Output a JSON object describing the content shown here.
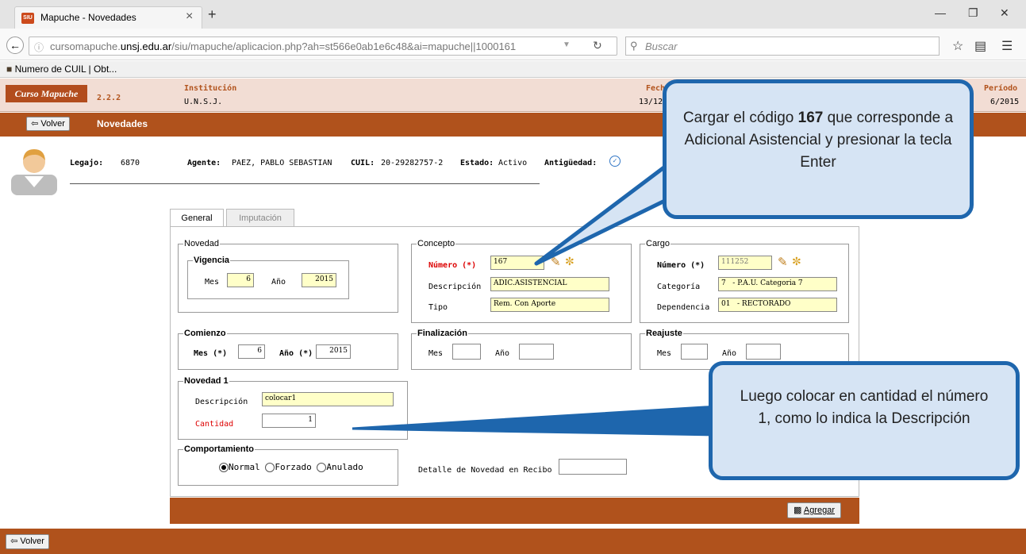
{
  "browser": {
    "tab_title": "Mapuche - Novedades",
    "tab_close": "×",
    "new_tab": "+",
    "url_prefix": "cursomapuche.",
    "url_domain": "unsj.edu.ar",
    "url_path": "/siu/mapuche/aplicacion.php?ah=st566e0ab1e6c48&ai=mapuche||1000161",
    "search_placeholder": "Buscar",
    "bookmark": "Numero de CUIL | Obt..."
  },
  "header": {
    "logo": "Curso Mapuche",
    "version": "2.2.2",
    "institucion_label": "Institución",
    "institucion_value": "U.N.S.J.",
    "fecha_label": "Fech",
    "fecha_value": "13/12/",
    "periodo_label": "Período",
    "periodo_value": "6/2015"
  },
  "toolbar": {
    "volver": "Volver",
    "title": "Novedades"
  },
  "agent": {
    "legajo_label": "Legajo:",
    "legajo_value": "6870",
    "agente_label": "Agente:",
    "agente_value": "PAEZ, PABLO SEBASTIAN",
    "cuil_label": "CUIL:",
    "cuil_value": "20-29282757-2",
    "estado_label": "Estado:",
    "estado_value": "Activo",
    "antiguedad_label": "Antigüedad:"
  },
  "tabs": [
    "General",
    "Imputación"
  ],
  "novedad": {
    "legend": "Novedad",
    "vigencia": "Vigencia",
    "mes_label": "Mes",
    "mes_value": "6",
    "anio_label": "Año",
    "anio_value": "2015"
  },
  "concepto": {
    "legend": "Concepto",
    "numero_label": "Número (*)",
    "numero_value": "167",
    "descripcion_label": "Descripción",
    "descripcion_value": "ADIC.ASISTENCIAL",
    "tipo_label": "Tipo",
    "tipo_value": "Rem. Con Aporte"
  },
  "cargo": {
    "legend": "Cargo",
    "numero_label": "Número (*)",
    "numero_value": "111252",
    "categoria_label": "Categoría",
    "categoria_value": "7   - P.A.U. Categoria 7",
    "dependencia_label": "Dependencia",
    "dependencia_value": "01   - RECTORADO"
  },
  "comienzo": {
    "legend": "Comienzo",
    "mes_label": "Mes (*)",
    "mes_value": "6",
    "anio_label": "Año (*)",
    "anio_value": "2015"
  },
  "finalizacion": {
    "legend": "Finalización",
    "mes_label": "Mes",
    "anio_label": "Año"
  },
  "reajuste": {
    "legend": "Reajuste",
    "mes_label": "Mes",
    "anio_label": "Año"
  },
  "novedad1": {
    "legend": "Novedad 1",
    "descripcion_label": "Descripción",
    "descripcion_value": "colocar1",
    "cantidad_label": "Cantidad",
    "cantidad_value": "1"
  },
  "comportamiento": {
    "legend": "Comportamiento",
    "options": [
      "Normal",
      "Forzado",
      "Anulado"
    ],
    "selected": "Normal"
  },
  "detalle_label": "Detalle de Novedad en Recibo",
  "agregar": "Agregar",
  "callouts": {
    "top_pre": "Cargar el código ",
    "top_bold": "167",
    "top_post": " que corresponde a Adicional Asistencial y presionar la tecla Enter",
    "bottom": "Luego colocar en cantidad el número 1, como lo indica la Descripción"
  },
  "colors": {
    "brand_bar": "#b0521c",
    "callout_border": "#1e66ad",
    "callout_fill": "#d6e4f4",
    "required_label": "#dd0000"
  }
}
